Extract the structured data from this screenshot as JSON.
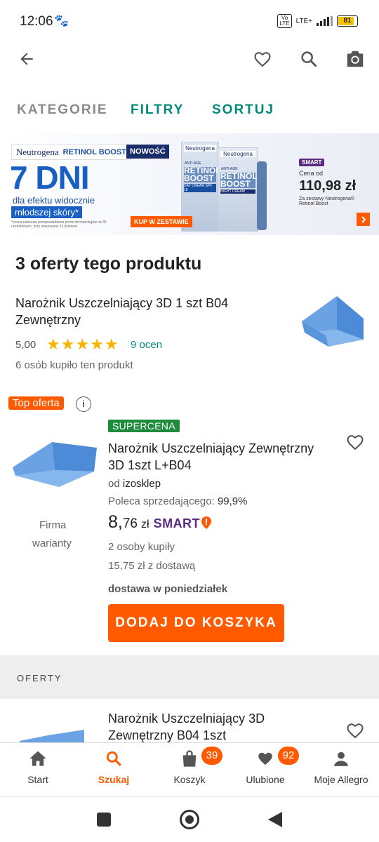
{
  "status_bar": {
    "time": "12:06",
    "network": "LTE+",
    "battery": "81",
    "volte": "Vo\nLTE"
  },
  "app_bar": {
    "back": "back-arrow",
    "icons": [
      "heart-icon",
      "search-icon",
      "camera-icon"
    ]
  },
  "tabs": {
    "categories": "KATEGORIE",
    "filters": "FILTRY",
    "sort": "SORTUJ"
  },
  "banner": {
    "brand": "Neutrogena",
    "line": "RETINOL BOOST",
    "badge_new": "NOWOŚĆ",
    "headline": "7 DNI",
    "sub1": "dla efektu widocznie",
    "sub2": "młodszej skóry*",
    "footnote": "*ocena naukowa przeprowadzona przez dermatologów na 36 uczestnikach, przy stosowaniu 1x dziennie",
    "cta": "KUP W ZESTAWIE",
    "smart_label": "SMART",
    "price_label": "Cena od",
    "price": "110,98 zł",
    "price_note": "Za zestawy Neutrogena® Retinol Boost",
    "box1": "RETINOL BOOST",
    "box1_small": "DAY CREAM SPF 15",
    "box2": "RETINOL BOOST",
    "box2_small": "NIGHT CREAM",
    "anti_age": "ANTI-AGE"
  },
  "offers_title": "3 oferty tego produktu",
  "product": {
    "name": "Narożnik Uszczelniający 3D 1 szt B04 Zewnętrzny",
    "rating": "5,00",
    "reviews": "9 ocen",
    "bought": "6 osób kupiło ten produkt",
    "stars": 5
  },
  "top_offer": {
    "tag": "Top oferta",
    "badge": "SUPERCENA",
    "title": "Narożnik Uszczelniający Zewnętrzny 3D 1szt L+B04",
    "seller_prefix": "od",
    "seller": "izosklep",
    "recommend_label": "Poleca sprzedającego:",
    "recommend_value": "99,9%",
    "price_int": "8,",
    "price_dec": "76",
    "currency": "zł",
    "smart": "SMART",
    "bought": "2 osoby kupiły",
    "delivery_price": "15,75 zł z dostawą",
    "delivery_day": "dostawa w poniedziałek",
    "seller_type": "Firma",
    "variants": "warianty",
    "add_to_cart": "DODAJ DO KOSZYKA"
  },
  "offers_section": "OFERTY",
  "second_offer": {
    "title": "Narożnik Uszczelniający 3D Zewnętrzny B04 1szt"
  },
  "bottom_nav": [
    {
      "label": "Start",
      "icon": "home-icon"
    },
    {
      "label": "Szukaj",
      "icon": "search-icon"
    },
    {
      "label": "Koszyk",
      "icon": "cart-icon",
      "badge": "39"
    },
    {
      "label": "Ulubione",
      "icon": "heart-icon",
      "badge": "92"
    },
    {
      "label": "Moje Allegro",
      "icon": "user-icon"
    }
  ],
  "colors": {
    "accent": "#ff5a00",
    "teal": "#00897b",
    "green_badge": "#1e8a3c",
    "smart_purple": "#5b2b82"
  }
}
